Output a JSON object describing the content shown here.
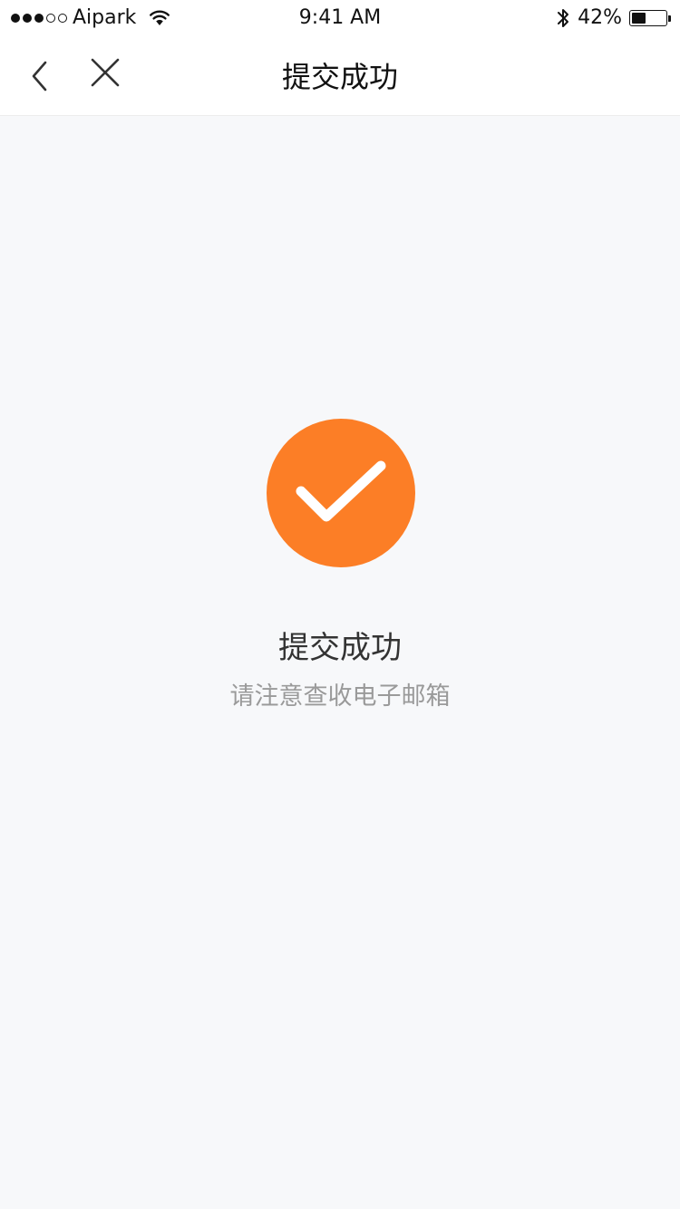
{
  "status_bar": {
    "carrier": "Aipark",
    "time": "9:41 AM",
    "battery_text": "42%",
    "battery_level": 0.42
  },
  "nav": {
    "title": "提交成功",
    "back_icon": "chevron-left-icon",
    "close_icon": "close-icon"
  },
  "result": {
    "icon": "check-icon",
    "title": "提交成功",
    "subtitle": "请注意查收电子邮箱"
  },
  "colors": {
    "accent": "#fc7e26",
    "background": "#f7f8fa"
  }
}
